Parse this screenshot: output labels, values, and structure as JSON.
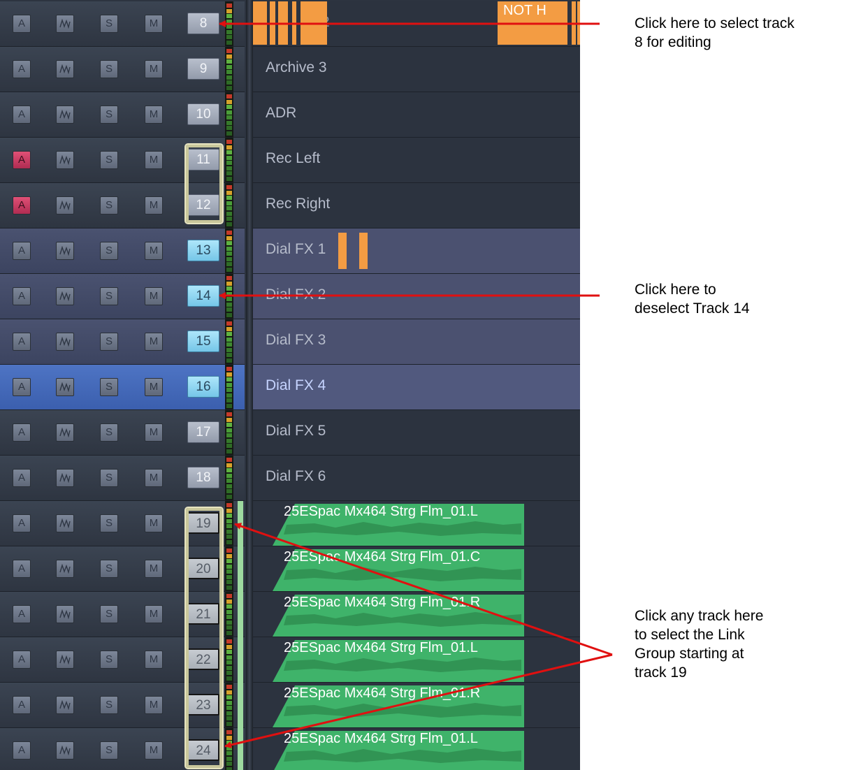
{
  "track_buttons": {
    "arm": "A",
    "waveform_icon": "waveform-icon",
    "solo": "S",
    "mute": "M"
  },
  "tracks": [
    {
      "num": "8",
      "name": "2",
      "state": "normal"
    },
    {
      "num": "9",
      "name": "Archive 3",
      "state": "normal"
    },
    {
      "num": "10",
      "name": "ADR",
      "state": "normal"
    },
    {
      "num": "11",
      "name": "Rec Left",
      "state": "armed"
    },
    {
      "num": "12",
      "name": "Rec Right",
      "state": "armed"
    },
    {
      "num": "13",
      "name": "Dial FX 1",
      "state": "selected"
    },
    {
      "num": "14",
      "name": "Dial FX 2",
      "state": "selected"
    },
    {
      "num": "15",
      "name": "Dial FX 3",
      "state": "selected"
    },
    {
      "num": "16",
      "name": "Dial FX 4",
      "state": "active"
    },
    {
      "num": "17",
      "name": "Dial FX 5",
      "state": "normal"
    },
    {
      "num": "18",
      "name": "Dial FX 6",
      "state": "normal"
    },
    {
      "num": "19",
      "name": "25ESpac Mx464 Strg Flm_01.L",
      "state": "linked"
    },
    {
      "num": "20",
      "name": "25ESpac Mx464 Strg Flm_01.C",
      "state": "linked"
    },
    {
      "num": "21",
      "name": "25ESpac Mx464 Strg Flm_01.R",
      "state": "linked"
    },
    {
      "num": "22",
      "name": "25ESpac Mx464 Strg Flm_01.L",
      "state": "linked"
    },
    {
      "num": "23",
      "name": "25ESpac Mx464 Strg Flm_01.R",
      "state": "linked"
    },
    {
      "num": "24",
      "name": "25ESpac Mx464 Strg Flm_01.L",
      "state": "linked"
    }
  ],
  "clip_labels": {
    "track8": "NOT H"
  },
  "annotations": {
    "select_track8": [
      "Click here to select track",
      "8 for editing"
    ],
    "deselect_track14": [
      "Click here to",
      "deselect Track 14"
    ],
    "link_group": [
      "Click any track here",
      "to select the Link",
      "Group starting at",
      "track 19"
    ]
  },
  "colors": {
    "panel": "#2d3440",
    "selected_number": "#8fd4f0",
    "armed": "#d13d65",
    "clip_orange": "#f39c43",
    "clip_green": "#3fb36a",
    "callout_line": "#e01010",
    "link_group": "#c9c79b"
  }
}
